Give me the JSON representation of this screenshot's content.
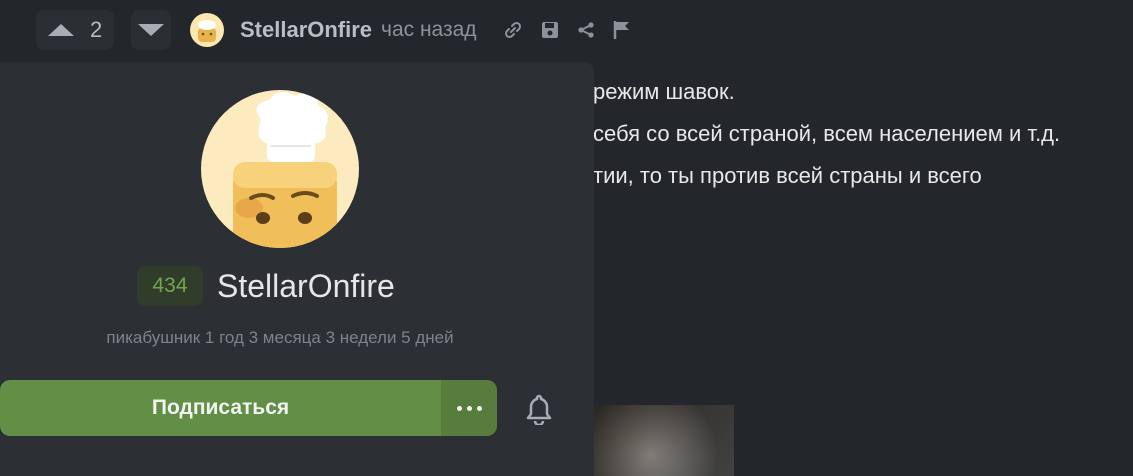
{
  "header": {
    "vote_count": "2",
    "author_name": "StellarOnfire",
    "time": "час назад",
    "icons": [
      "upvote-icon",
      "downvote-icon",
      "link-icon",
      "save-icon",
      "share-icon",
      "flag-icon"
    ]
  },
  "comment": {
    "lines": [
      "режим шавок.",
      "себя со всей страной, всем населением и т.д.",
      "тии, то ты против всей страны и всего"
    ]
  },
  "profile": {
    "rating": "434",
    "name": "StellarOnfire",
    "meta": "пикабушник 1 год 3 месяца 3 недели 5 дней",
    "subscribe_label": "Подписаться",
    "icons": [
      "more-icon",
      "bell-icon"
    ]
  },
  "colors": {
    "background": "#23262b",
    "popover": "#2c2f34",
    "accent_green": "#628e45",
    "rating_text": "#73a64e"
  }
}
